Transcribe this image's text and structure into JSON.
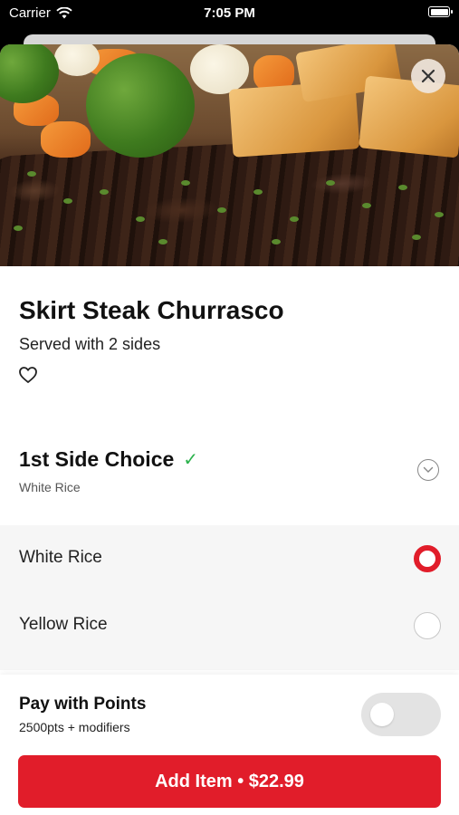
{
  "status_bar": {
    "carrier": "Carrier",
    "time": "7:05 PM"
  },
  "item": {
    "title": "Skirt Steak Churrasco",
    "subtitle": "Served with 2 sides"
  },
  "side_choice": {
    "title": "1st Side Choice",
    "selected": "White Rice",
    "options": [
      {
        "label": "White Rice",
        "selected": true
      },
      {
        "label": "Yellow Rice",
        "selected": false
      }
    ]
  },
  "points": {
    "title": "Pay with Points",
    "subtitle": "2500pts + modifiers",
    "enabled": false
  },
  "add_button": {
    "label": "Add Item • $22.99"
  },
  "colors": {
    "accent": "#e11d2a",
    "check": "#2bb24c"
  }
}
